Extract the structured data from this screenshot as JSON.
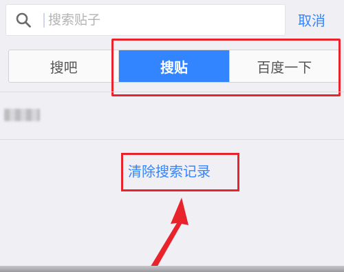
{
  "search": {
    "placeholder": "搜索贴子",
    "value": "",
    "cancel_label": "取消"
  },
  "tabs": [
    {
      "label": "搜吧",
      "active": false
    },
    {
      "label": "搜贴",
      "active": true
    },
    {
      "label": "百度一下",
      "active": false
    }
  ],
  "history": {
    "items": [
      "(blurred history entry)"
    ],
    "clear_label": "清除搜索记录"
  },
  "annotations": {
    "highlight_color": "#e8232b"
  },
  "colors": {
    "accent": "#3385ff",
    "background": "#efeff4"
  },
  "icons": [
    "search-icon",
    "arrow-icon"
  ]
}
